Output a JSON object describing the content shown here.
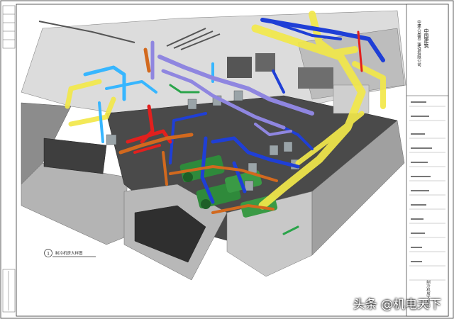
{
  "title_block": {
    "company_line1": "中国建筑",
    "company_line2": "中建八局第二建设有限公司",
    "drawing_name": "制冷机房大样图"
  },
  "callout": {
    "number": "1",
    "label": "制冷机房大样图"
  },
  "watermark": "头条 @机电天下",
  "colors": {
    "supply_blue": "#1f3fd6",
    "return_yellow": "#f2e84a",
    "condenser_purple": "#8f86e0",
    "chilled_red": "#e2201e",
    "pipe_orange": "#d2691e",
    "chiller_green": "#2f8a3b",
    "cyan_pipe": "#37b6ff",
    "wall_grey": "#9a9a9a",
    "floor_dark": "#3a3a3a"
  }
}
